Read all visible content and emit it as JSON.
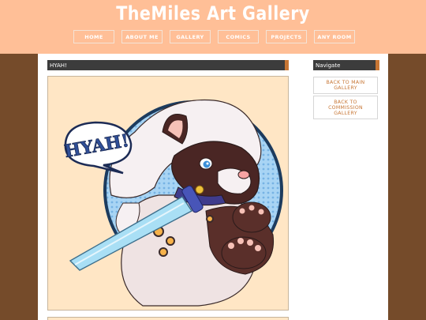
{
  "site": {
    "title": "TheMiles Art Gallery"
  },
  "nav": {
    "items": [
      {
        "label": "HOME"
      },
      {
        "label": "ABOUT ME"
      },
      {
        "label": "GALLERY"
      },
      {
        "label": "COMICS"
      },
      {
        "label": "PROJECTS"
      },
      {
        "label": "ANY ROOM"
      }
    ]
  },
  "main": {
    "post_title": "HYAH!",
    "artwork": {
      "speech_text": "HYAH!"
    }
  },
  "sidebar": {
    "heading": "Navigate",
    "back_main": [
      "BACK TO MAIN",
      "GALLERY"
    ],
    "back_commission": [
      "BACK TO",
      "COMMISSION",
      "GALLERY"
    ]
  },
  "colors": {
    "header_bg": "#ffbf97",
    "page_bg": "#754b2a",
    "accent": "#c77634",
    "bar_bg": "#3c3c3c"
  }
}
